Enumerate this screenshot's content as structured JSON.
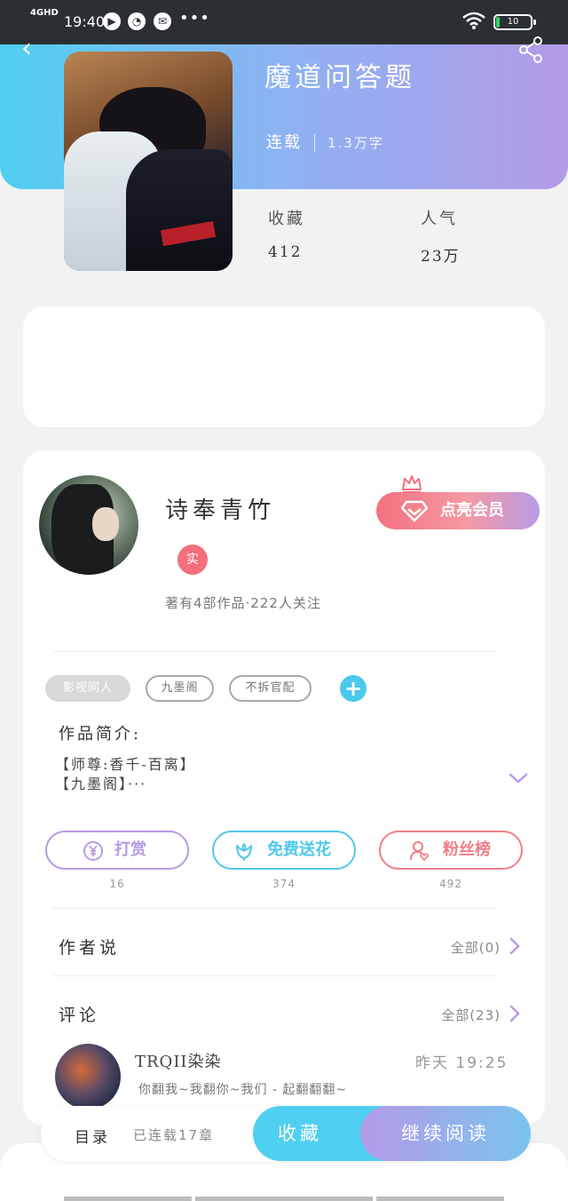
{
  "status_bar": {
    "network": "4GHD",
    "time": "19:40",
    "battery": "10",
    "more": "•••"
  },
  "book": {
    "title": "魔道问答题",
    "status": "连载",
    "word_count": "1.3万字"
  },
  "stats": {
    "favorites_label": "收藏",
    "favorites_value": "412",
    "popularity_label": "人气",
    "popularity_value": "23万"
  },
  "author": {
    "name": "诗奉青竹",
    "badge": "实",
    "stats": "著有4部作品·222人关注",
    "vip_button": "点亮会员"
  },
  "tags": [
    "影视同人",
    "九墨阁",
    "不拆官配"
  ],
  "add_tag": "+",
  "intro": {
    "label": "作品简介:",
    "line1": "【师尊:香千-百离】",
    "line2": "【九墨阁】···"
  },
  "actions": [
    {
      "label": "打赏",
      "count": "16",
      "color": "#b79be3"
    },
    {
      "label": "免费送花",
      "count": "374",
      "color": "#4fc8ea"
    },
    {
      "label": "粉丝榜",
      "count": "492",
      "color": "#ef7f86"
    }
  ],
  "author_says": {
    "label": "作者说",
    "all": "全部(0)"
  },
  "comments": {
    "label": "评论",
    "all": "全部(23)"
  },
  "comment": {
    "user": "TRQII染染",
    "time": "昨天 19:25",
    "text": "你翻我~我翻你~我们 - 起翻翻翻~"
  },
  "bottom": {
    "catalog": "目录",
    "chapters": "已连载17章",
    "favorite": "收藏",
    "continue": "继续阅读"
  },
  "colors": {
    "accent_cyan": "#4fd0f0",
    "accent_purple": "#b39be8",
    "accent_pink": "#f4707f"
  }
}
